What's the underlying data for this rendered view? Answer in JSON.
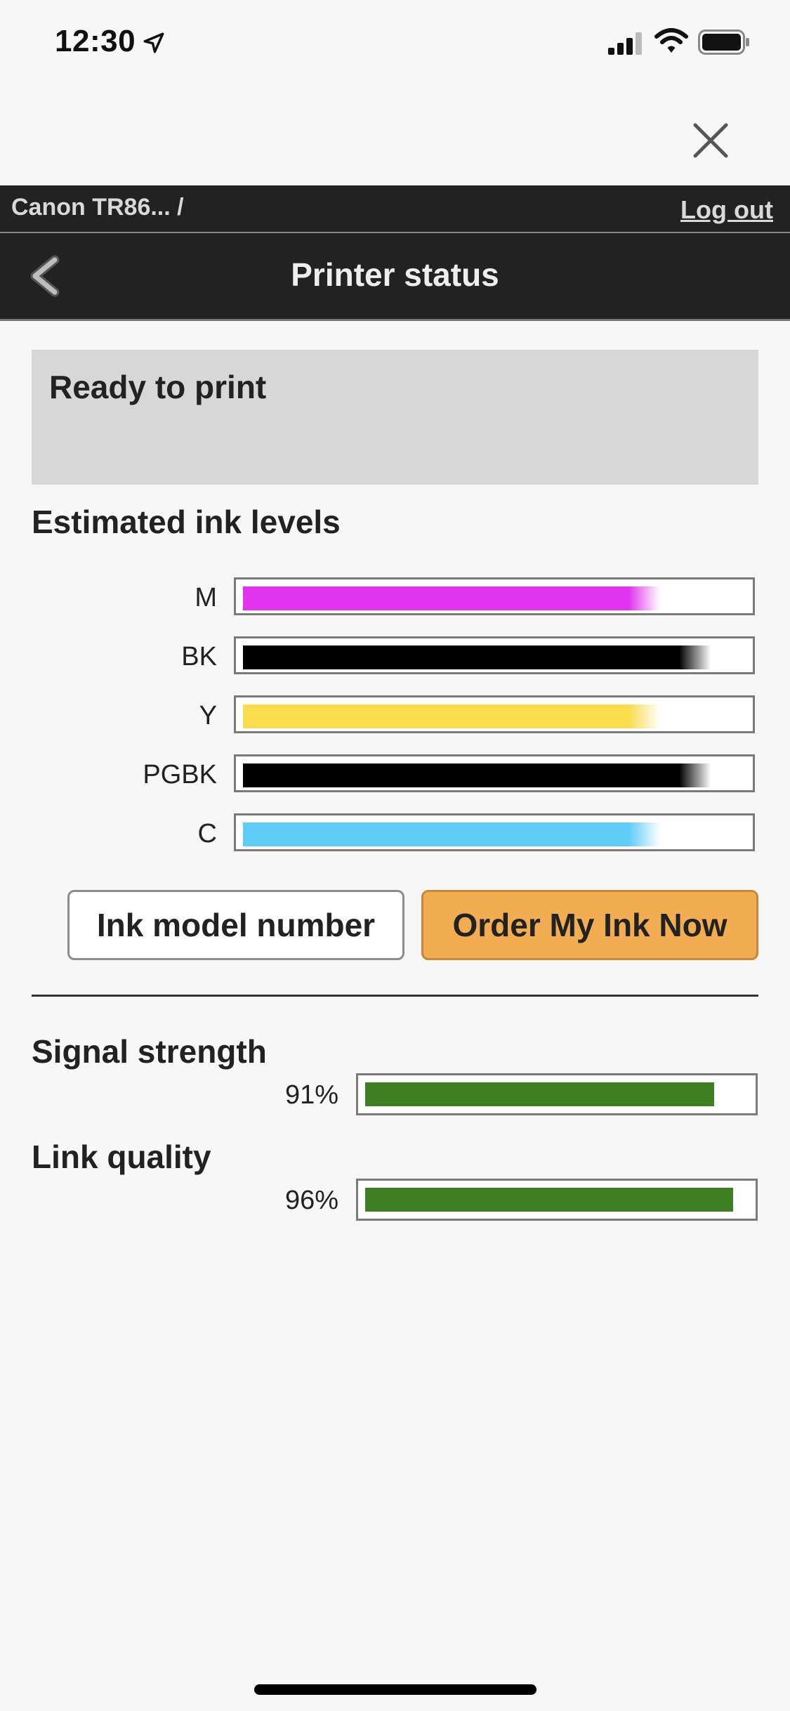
{
  "status_bar": {
    "time": "12:30",
    "location_icon": "location-arrow-icon",
    "signal_icon": "cellular-signal-icon",
    "wifi_icon": "wifi-icon",
    "battery_icon": "battery-icon"
  },
  "close_icon": "close-icon",
  "breadcrumb": {
    "printer": "Canon TR86... /",
    "logout": "Log out"
  },
  "header": {
    "back_icon": "chevron-left-icon",
    "title": "Printer status"
  },
  "status": {
    "message": "Ready to print"
  },
  "ink": {
    "heading": "Estimated ink levels",
    "cartridges": [
      {
        "label": "M",
        "level": 0.83,
        "color": "#e033ee"
      },
      {
        "label": "BK",
        "level": 0.93,
        "color": "#000000"
      },
      {
        "label": "Y",
        "level": 0.83,
        "color": "#fadc4d"
      },
      {
        "label": "PGBK",
        "level": 0.93,
        "color": "#000000"
      },
      {
        "label": "C",
        "level": 0.83,
        "color": "#5fcbf8"
      }
    ]
  },
  "buttons": {
    "model": "Ink model number",
    "order": "Order My Ink Now"
  },
  "signal": {
    "heading": "Signal strength",
    "value": "91%",
    "level": 0.91
  },
  "link": {
    "heading": "Link quality",
    "value": "96%",
    "level": 0.96
  },
  "colors": {
    "header_bg": "#222222",
    "order_button": "#f2ac52",
    "meter_green": "#3f7f24"
  }
}
